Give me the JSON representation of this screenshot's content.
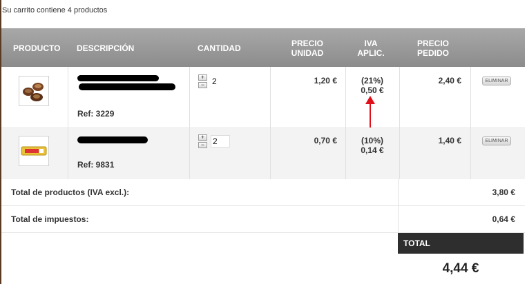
{
  "cart": {
    "summary": "Su carrito contiene 4 productos"
  },
  "columns": {
    "producto": "PRODUCTO",
    "descripcion": "DESCRIPCIÓN",
    "cantidad": "CANTIDAD",
    "precio_unidad_1": "PRECIO",
    "precio_unidad_2": "UNIDAD",
    "iva_1": "IVA",
    "iva_2": "APLIC.",
    "precio_pedido_1": "PRECIO",
    "precio_pedido_2": "PEDIDO"
  },
  "items": [
    {
      "ref": "Ref: 3229",
      "quantity": "2",
      "unit_price": "1,20 €",
      "iva_rate": "(21%)",
      "iva_amount": "0,50 €",
      "line_total": "2,40 €",
      "delete_label": "ELIMINAR",
      "thumb_icon": "chocolate-bonbons-image"
    },
    {
      "ref": "Ref: 9831",
      "quantity": "2",
      "unit_price": "0,70 €",
      "iva_rate": "(10%)",
      "iva_amount": "0,14 €",
      "line_total": "1,40 €",
      "delete_label": "ELIMINAR",
      "thumb_icon": "candy-wrapper-image"
    }
  ],
  "qty_controls": {
    "plus": "+",
    "minus": "−"
  },
  "totals": {
    "products_label": "Total de productos (IVA excl.):",
    "products_value": "3,80 €",
    "taxes_label": "Total de impuestos:",
    "taxes_value": "0,64 €",
    "total_label": "TOTAL",
    "total_value": "4,44 €"
  },
  "colors": {
    "header_bg": "#999999",
    "total_bg": "#2e2e2e",
    "annotation_arrow": "#e0101a"
  }
}
